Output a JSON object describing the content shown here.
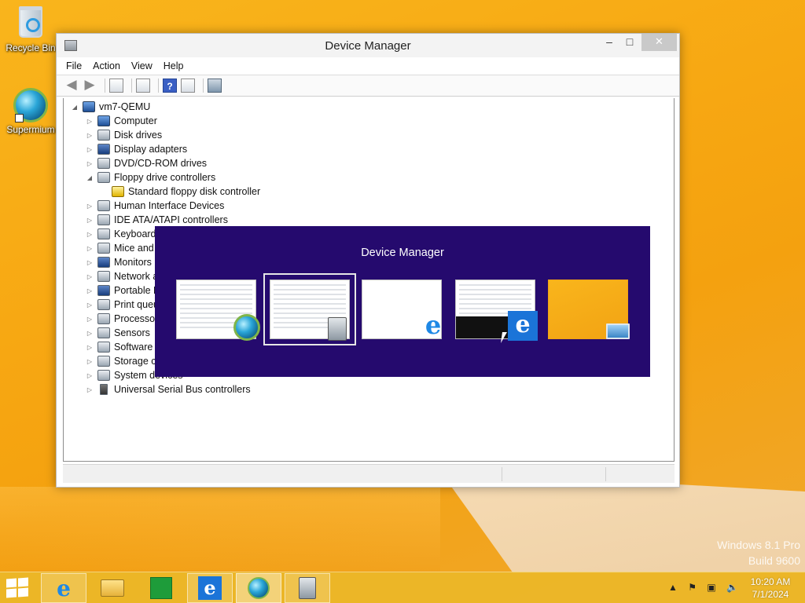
{
  "desktop": {
    "icons": [
      {
        "label": "Recycle Bin",
        "icon": "recycle-bin-icon"
      },
      {
        "label": "Supermium",
        "icon": "supermium-browser-icon"
      }
    ],
    "watermark": {
      "line1": "Windows 8.1 Pro",
      "line2": "Build 9600"
    }
  },
  "window": {
    "title": "Device Manager",
    "menu": [
      "File",
      "Action",
      "View",
      "Help"
    ],
    "toolbar": [
      "back-arrow-icon",
      "forward-arrow-icon",
      "show-hide-console-tree-icon",
      "properties-icon",
      "help-icon",
      "action-pane-icon",
      "scan-hardware-changes-icon"
    ],
    "tree": {
      "root": "vm7-QEMU",
      "items": [
        {
          "label": "Computer",
          "expanded": false,
          "icon": "computer-icon"
        },
        {
          "label": "Disk drives",
          "expanded": false,
          "icon": "disk-drive-icon"
        },
        {
          "label": "Display adapters",
          "expanded": false,
          "icon": "display-adapter-icon"
        },
        {
          "label": "DVD/CD-ROM drives",
          "expanded": false,
          "icon": "dvd-drive-icon"
        },
        {
          "label": "Floppy drive controllers",
          "expanded": true,
          "icon": "floppy-controller-icon"
        },
        {
          "label": "Standard floppy disk controller",
          "child": true,
          "icon": "floppy-controller-warning-icon"
        },
        {
          "label": "Human Interface Devices",
          "expanded": false,
          "icon": "hid-icon"
        },
        {
          "label": "IDE ATA/ATAPI controllers",
          "expanded": false,
          "icon": "ide-controller-icon"
        },
        {
          "label": "Keyboards",
          "expanded": false,
          "icon": "keyboard-icon"
        },
        {
          "label": "Mice and o",
          "expanded": false,
          "icon": "mouse-icon"
        },
        {
          "label": "Monitors",
          "expanded": false,
          "icon": "monitor-icon"
        },
        {
          "label": "Network a",
          "expanded": false,
          "icon": "network-adapter-icon"
        },
        {
          "label": "Portable D",
          "expanded": false,
          "icon": "portable-device-icon"
        },
        {
          "label": "Print queu",
          "expanded": false,
          "icon": "printer-icon"
        },
        {
          "label": "Processors",
          "expanded": false,
          "icon": "processor-icon"
        },
        {
          "label": "Sensors",
          "expanded": false,
          "icon": "sensor-icon"
        },
        {
          "label": "Software c",
          "expanded": false,
          "icon": "software-component-icon"
        },
        {
          "label": "Storage co",
          "expanded": false,
          "icon": "storage-controller-icon"
        },
        {
          "label": "System devices",
          "expanded": false,
          "icon": "system-device-icon"
        },
        {
          "label": "Universal Serial Bus controllers",
          "expanded": false,
          "icon": "usb-icon"
        }
      ]
    }
  },
  "task_switcher": {
    "title": "Device Manager",
    "thumbnails": [
      {
        "app": "Supermium",
        "icon": "supermium-browser-icon",
        "selected": false
      },
      {
        "app": "Device Manager",
        "icon": "device-manager-icon",
        "selected": true
      },
      {
        "app": "Internet Explorer",
        "icon": "internet-explorer-icon",
        "selected": false
      },
      {
        "app": "Internet Explorer",
        "icon": "internet-explorer-tile-icon",
        "selected": false
      },
      {
        "app": "Desktop",
        "icon": "desktop-icon",
        "selected": false
      }
    ]
  },
  "taskbar": {
    "apps": [
      "internet-explorer-icon",
      "file-explorer-icon",
      "store-icon",
      "internet-explorer-icon",
      "supermium-browser-icon",
      "device-manager-icon"
    ],
    "active_index": 4,
    "clock": {
      "time": "10:20 AM",
      "date": "7/1/2024"
    }
  },
  "colors": {
    "switcher_bg": "#250a6e",
    "taskbar": "#ecb728",
    "wallpaper": "#f7a712"
  }
}
